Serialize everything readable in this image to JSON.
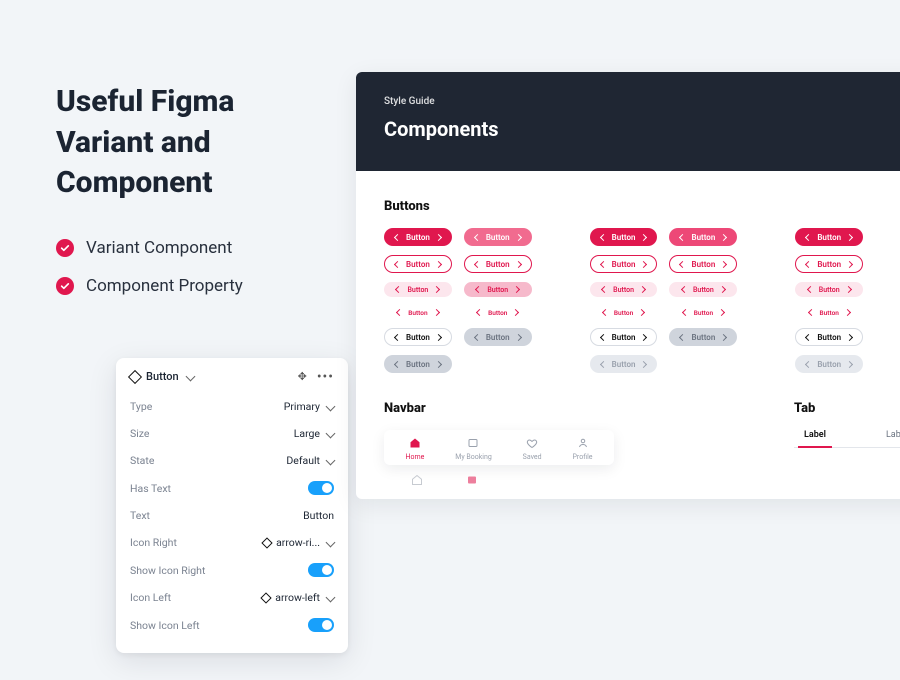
{
  "headline": "Useful Figma Variant and Component",
  "bullets": [
    "Variant Component",
    "Component Property"
  ],
  "panel": {
    "title": "Button",
    "rows": {
      "type": {
        "label": "Type",
        "value": "Primary"
      },
      "size": {
        "label": "Size",
        "value": "Large"
      },
      "state": {
        "label": "State",
        "value": "Default"
      },
      "has_text": {
        "label": "Has Text"
      },
      "text": {
        "label": "Text",
        "value": "Button"
      },
      "icon_right": {
        "label": "Icon Right",
        "value": "arrow-ri..."
      },
      "show_icon_right": {
        "label": "Show Icon Right"
      },
      "icon_left": {
        "label": "Icon Left",
        "value": "arrow-left"
      },
      "show_icon_left": {
        "label": "Show Icon Left"
      }
    }
  },
  "guide": {
    "eyebrow": "Style Guide",
    "title": "Components",
    "sections": {
      "buttons": "Buttons",
      "navbar": "Navbar",
      "tab": "Tab"
    },
    "btn_label": "Button",
    "nav_items": [
      {
        "label": "Home",
        "active": true
      },
      {
        "label": "My Booking",
        "active": false
      },
      {
        "label": "Saved",
        "active": false
      },
      {
        "label": "Profile",
        "active": false
      }
    ],
    "tabs": [
      {
        "label": "Label",
        "active": true
      },
      {
        "label": "Label",
        "active": false
      }
    ]
  },
  "colors": {
    "accent": "#e0174e",
    "toggleBlue": "#18a0fb",
    "heroBg": "#1f2633"
  }
}
